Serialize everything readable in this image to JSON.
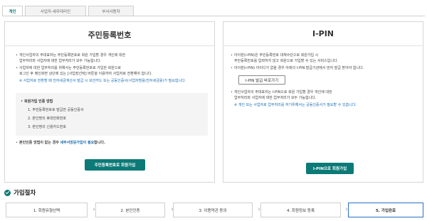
{
  "tabs": [
    {
      "label": "개인"
    },
    {
      "label": "사업자·세무대리인"
    },
    {
      "label": "부서사용자"
    }
  ],
  "left_panel": {
    "title": "주민등록번호",
    "paragraph1": [
      "개인사업자의 주대표자는 주민등록번호로 회원 가입할 경우 개인에 대한",
      "업무처리와 사업자에 대한 업무처리가 모두 가능합니다."
    ],
    "paragraph2": [
      "사업자에 대한 업무처리를 위해서는 주민등록번호로 가입한 회원으로",
      "로그인 후 메인화면 상단에 있는 [사업장선택] 버튼을 이용하여 사업자로 전환해야 합니다."
    ],
    "note": "※ 사업자로 전환할 때 전자세금계산서 발급 시 보안카드 또는 공동인증서(사업자범용/전자세금용)가 필요합니다.",
    "methods_title": "회원가입 인증 방법",
    "methods": [
      "1. 주민등록번호로 발급한 공동인증서",
      "2. 본인명의 휴대전화번호",
      "3. 본인명의 신용카드번호"
    ],
    "no_auth_text": "본인인증 방법이 없는 경우",
    "no_auth_link": "세무서방문가입이 필요",
    "no_auth_suffix": "합니다.",
    "signup_button": "주민등록번호로 회원가입"
  },
  "right_panel": {
    "title": "I-PIN",
    "paragraph1": [
      "아이핀(i-PIN)은 주민등록번호 대체수단으로 회원가입 시",
      "주민등록번호를 입력하지 않고 회원으로 가입할 수 있는 서비스입니다."
    ],
    "paragraph2": "아이핀(i-PIN) 아이디가 없을 경우 아래의 I-PIN 발급기관에서 먼저 발급 받아야 합니다.",
    "issue_button": "I-PIN 발급 바로가기",
    "paragraph3": [
      "개인사업자의 주대표자는 I-PIN으로 회원 가입할 경우 개인에 대한",
      "업무처리와 사업자에 대한 업무처리가 모두 가능합니다."
    ],
    "note": "※ 개인 또는 사업자로 업무처리를 하기위해서는 공동인증서가 필요할 수 있습니다.",
    "signup_button": "I-PIN으로 회원가입"
  },
  "steps_section": {
    "title": "가입절차",
    "steps": [
      {
        "label": "1. 회원유형선택"
      },
      {
        "label": "2. 본인인증"
      },
      {
        "label": "3. 이용약관 동의"
      },
      {
        "label": "4. 회원정보 등록"
      },
      {
        "label": "5. 가입완료"
      }
    ],
    "arrow_icon": "chevron-right-icon"
  },
  "colors": {
    "accent": "#0c7a77",
    "note_blue": "#1a6fb5",
    "current_step_border": "#2a6ec4"
  }
}
